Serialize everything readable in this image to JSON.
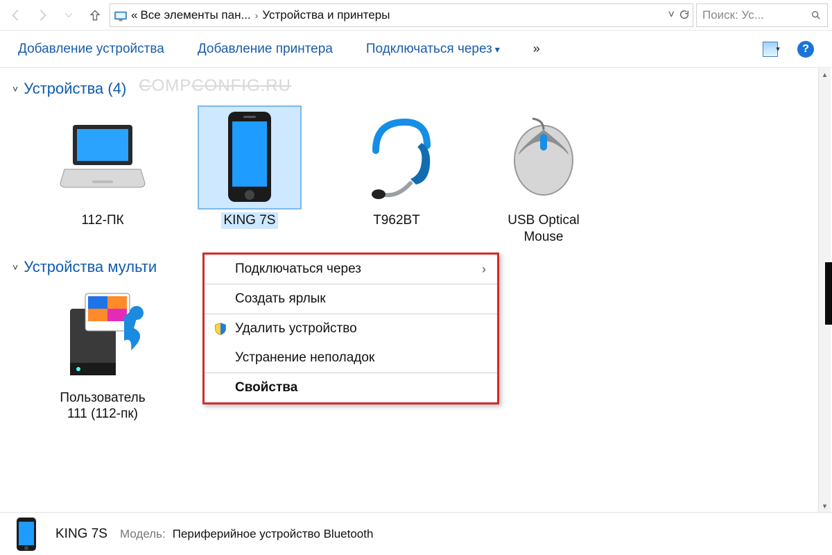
{
  "addressbar": {
    "crumb_prefix": "«",
    "crumb1": "Все элементы пан...",
    "crumb2": "Устройства и принтеры"
  },
  "search": {
    "placeholder": "Поиск: Ус..."
  },
  "toolbar": {
    "add_device": "Добавление устройства",
    "add_printer": "Добавление принтера",
    "connect_via": "Подключаться через",
    "overflow": "»"
  },
  "groups": {
    "devices": {
      "label": "Устройства",
      "count": "(4)"
    },
    "multimedia": {
      "label": "Устройства мульти"
    }
  },
  "watermark": {
    "a": "C",
    "b": "OMP",
    "c": "CONFIG.RU"
  },
  "devices": [
    {
      "name": "112-ПК",
      "icon": "laptop-icon"
    },
    {
      "name": "KING 7S",
      "icon": "phone-icon",
      "selected": true
    },
    {
      "name": "T962BT",
      "icon": "headset-icon"
    },
    {
      "name": "USB Optical\nMouse",
      "icon": "mouse-icon"
    }
  ],
  "multimedia_devices": [
    {
      "name": "Пользователь\n111 (112-пк)",
      "icon": "media-server-icon"
    }
  ],
  "context_menu": {
    "items": [
      {
        "label": "Подключаться через",
        "has_submenu": true
      },
      {
        "divider": true
      },
      {
        "label": "Создать ярлык"
      },
      {
        "divider": true
      },
      {
        "label": "Удалить устройство",
        "icon": "shield"
      },
      {
        "label": "Устранение неполадок"
      },
      {
        "divider": true
      },
      {
        "label": "Свойства",
        "bold": true
      }
    ]
  },
  "statusbar": {
    "title": "KING 7S",
    "model_label": "Модель:",
    "model_value": "Периферийное устройство Bluetooth"
  }
}
